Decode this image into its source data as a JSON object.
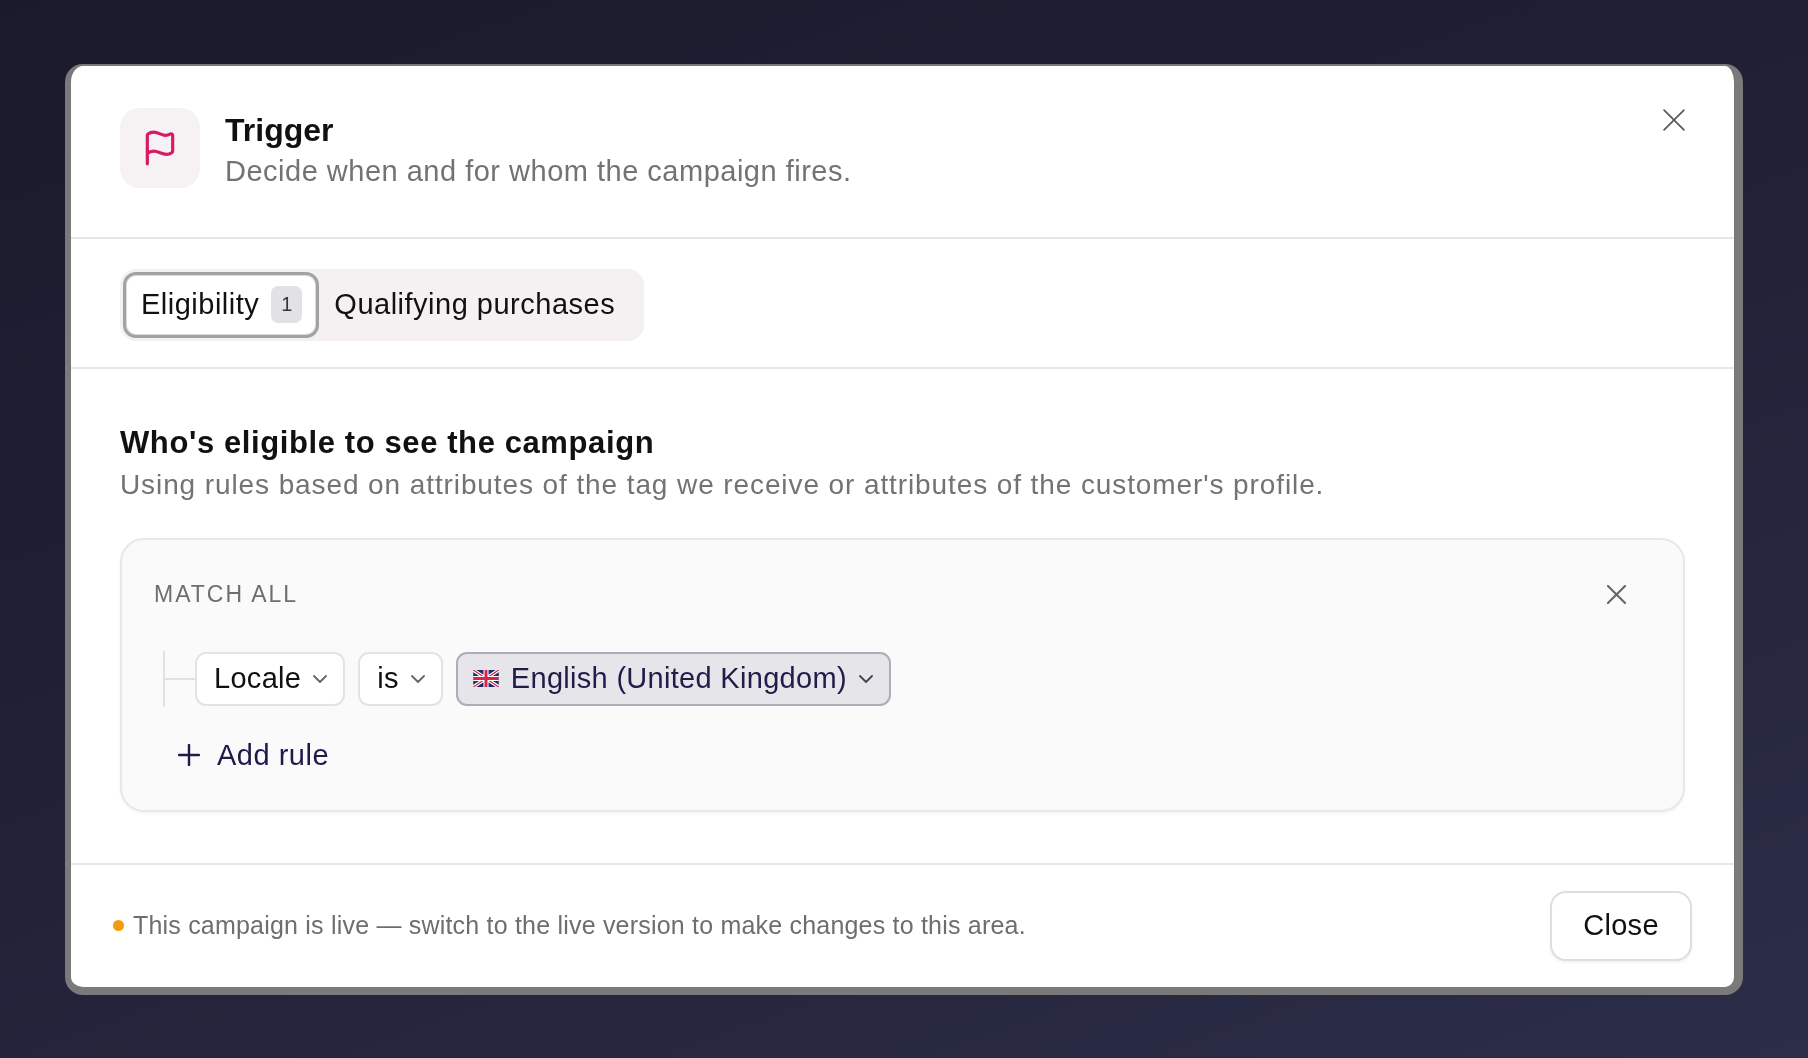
{
  "dialog": {
    "title": "Trigger",
    "subtitle": "Decide when and for whom the campaign fires."
  },
  "tabs": [
    {
      "label": "Eligibility",
      "badge": "1",
      "selected": true
    },
    {
      "label": "Qualifying purchases",
      "selected": false
    }
  ],
  "section": {
    "heading": "Who's eligible to see the campaign",
    "description": "Using rules based on attributes of the tag we receive or attributes of the customer's profile."
  },
  "rule_group": {
    "match_label": "MATCH ALL",
    "rules": [
      {
        "field": "Locale",
        "operator": "is",
        "value": "English (United Kingdom)"
      }
    ],
    "add_rule": "Add rule"
  },
  "footer": {
    "notice": "This campaign is live — switch to the live version to make changes to this area.",
    "close_button": "Close"
  }
}
